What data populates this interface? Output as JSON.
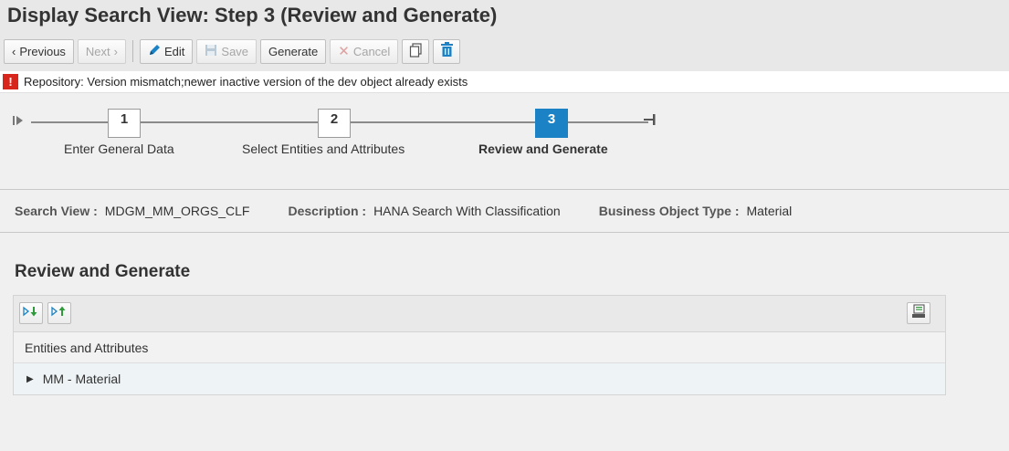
{
  "page": {
    "title": "Display Search View: Step 3  (Review and Generate)"
  },
  "toolbar": {
    "previous_label": "Previous",
    "next_label": "Next",
    "edit_label": "Edit",
    "save_label": "Save",
    "generate_label": "Generate",
    "cancel_label": "Cancel"
  },
  "message": {
    "icon": "!",
    "text": "Repository: Version mismatch;newer inactive version of the dev object already exists"
  },
  "roadmap": {
    "steps": [
      {
        "number": "1",
        "label": "Enter General Data",
        "active": false
      },
      {
        "number": "2",
        "label": "Select Entities and Attributes",
        "active": false
      },
      {
        "number": "3",
        "label": "Review and Generate",
        "active": true
      }
    ]
  },
  "info": {
    "search_view_label": "Search View :",
    "search_view_value": "MDGM_MM_ORGS_CLF",
    "description_label": "Description :",
    "description_value": "HANA Search With Classification",
    "bo_type_label": "Business Object Type :",
    "bo_type_value": "Material"
  },
  "section": {
    "title": "Review and Generate"
  },
  "table": {
    "column_header": "Entities and Attributes",
    "rows": [
      {
        "label": "MM - Material"
      }
    ]
  },
  "colors": {
    "active_step": "#1b82c5",
    "error": "#d9261c",
    "delete_icon": "#1b82c5"
  }
}
